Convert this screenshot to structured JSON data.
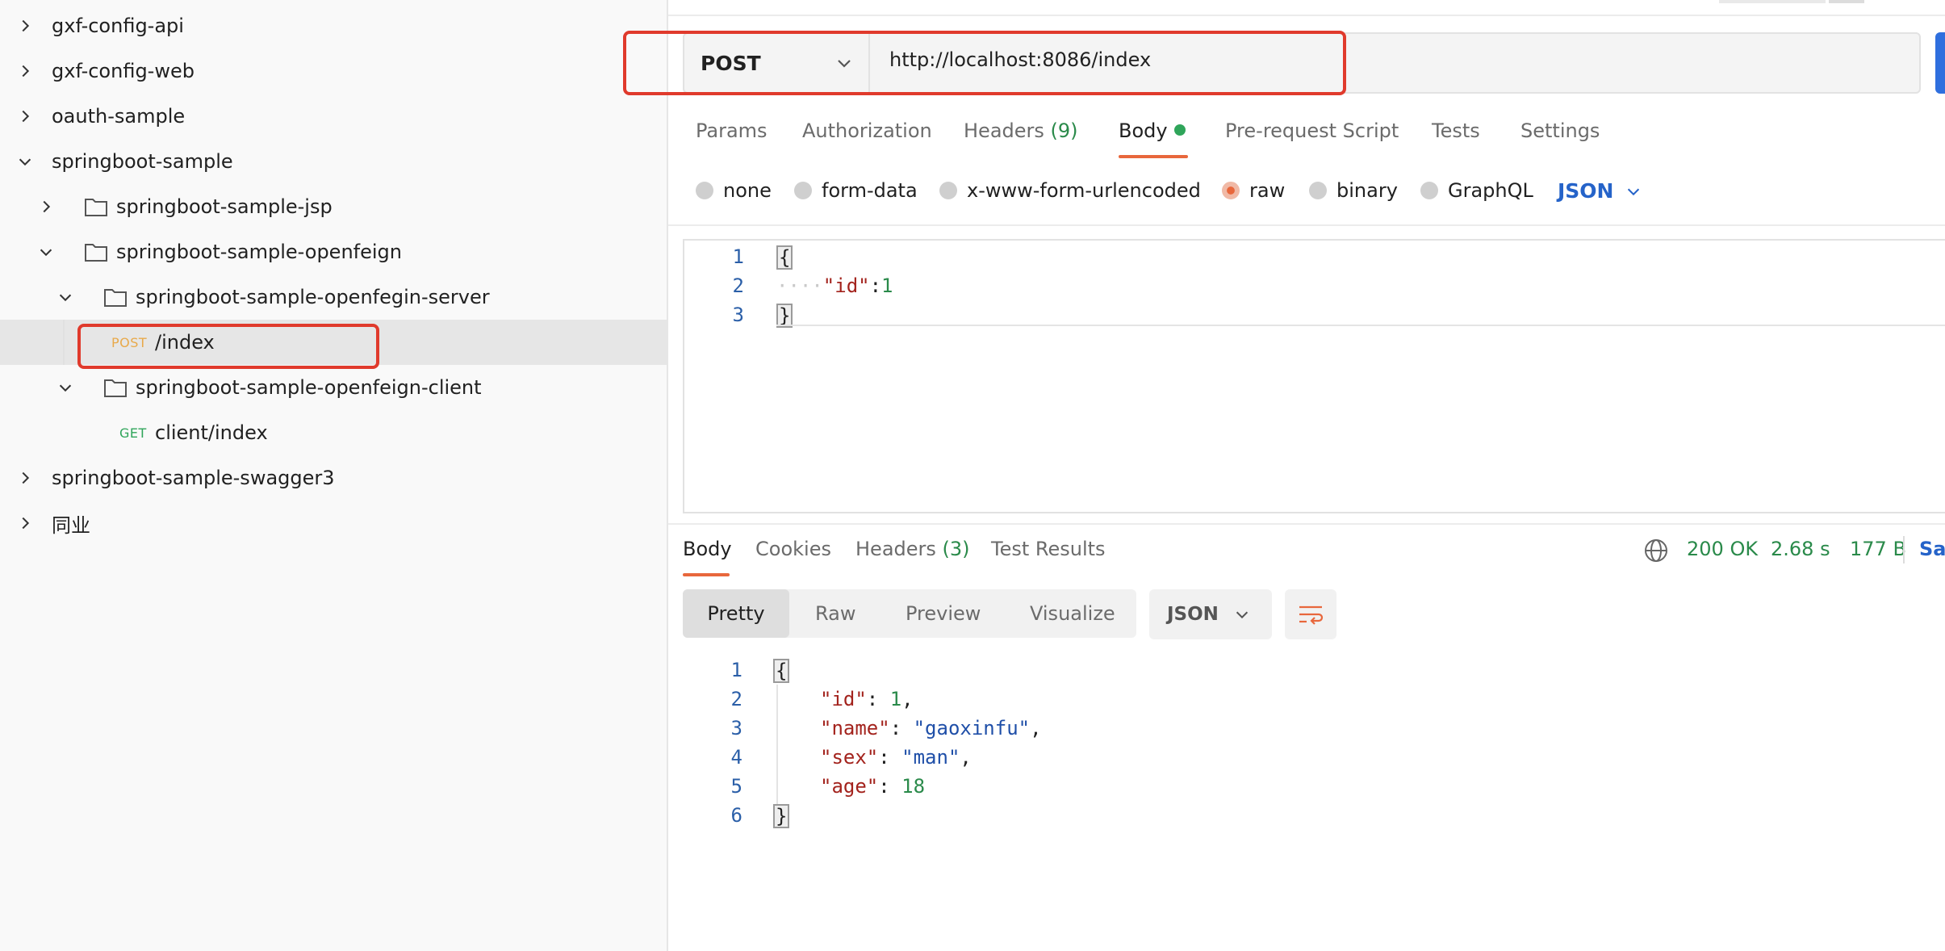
{
  "sidebar": {
    "items": [
      {
        "label": "gxf-config-api"
      },
      {
        "label": "gxf-config-web"
      },
      {
        "label": "oauth-sample"
      },
      {
        "label": "springboot-sample"
      },
      {
        "label": "springboot-sample-jsp"
      },
      {
        "label": "springboot-sample-openfeign"
      },
      {
        "label": "springboot-sample-openfegin-server"
      },
      {
        "label": "/index",
        "method": "POST"
      },
      {
        "label": "springboot-sample-openfeign-client"
      },
      {
        "label": "client/index",
        "method": "GET"
      },
      {
        "label": "springboot-sample-swagger3"
      },
      {
        "label": "同业"
      }
    ]
  },
  "request": {
    "method": "POST",
    "url": "http://localhost:8086/index",
    "tabs": {
      "params": "Params",
      "authorization": "Authorization",
      "headers": "Headers",
      "headers_count": "(9)",
      "body": "Body",
      "prerequest": "Pre-request Script",
      "tests": "Tests",
      "settings": "Settings"
    },
    "body_types": {
      "none": "none",
      "form_data": "form-data",
      "urlencoded": "x-www-form-urlencoded",
      "raw": "raw",
      "binary": "binary",
      "graphql": "GraphQL"
    },
    "body_format": "JSON",
    "body_lines": {
      "n1": "1",
      "n2": "2",
      "n3": "3",
      "open": "{",
      "indent": "····",
      "key": "\"id\"",
      "colon": ":",
      "value": "1",
      "close": "}"
    }
  },
  "response": {
    "tabs": {
      "body": "Body",
      "cookies": "Cookies",
      "headers": "Headers",
      "headers_count": "(3)",
      "test_results": "Test Results"
    },
    "status": "200 OK",
    "time": "2.68 s",
    "size": "177 B",
    "save_label": "Sav",
    "views": {
      "pretty": "Pretty",
      "raw": "Raw",
      "preview": "Preview",
      "visualize": "Visualize"
    },
    "format": "JSON",
    "lines": {
      "n1": "1",
      "n2": "2",
      "n3": "3",
      "n4": "4",
      "n5": "5",
      "n6": "6",
      "open": "{",
      "close": "}",
      "id_key": "\"id\"",
      "id_value": "1",
      "name_key": "\"name\"",
      "name_value": "\"gaoxinfu\"",
      "sex_key": "\"sex\"",
      "sex_value": "\"man\"",
      "age_key": "\"age\"",
      "age_value": "18"
    }
  },
  "colors": {
    "accent_orange": "#e8673c",
    "highlight_red": "#e03a2c",
    "success_green": "#2a8a4a",
    "link_blue": "#2563c9"
  }
}
